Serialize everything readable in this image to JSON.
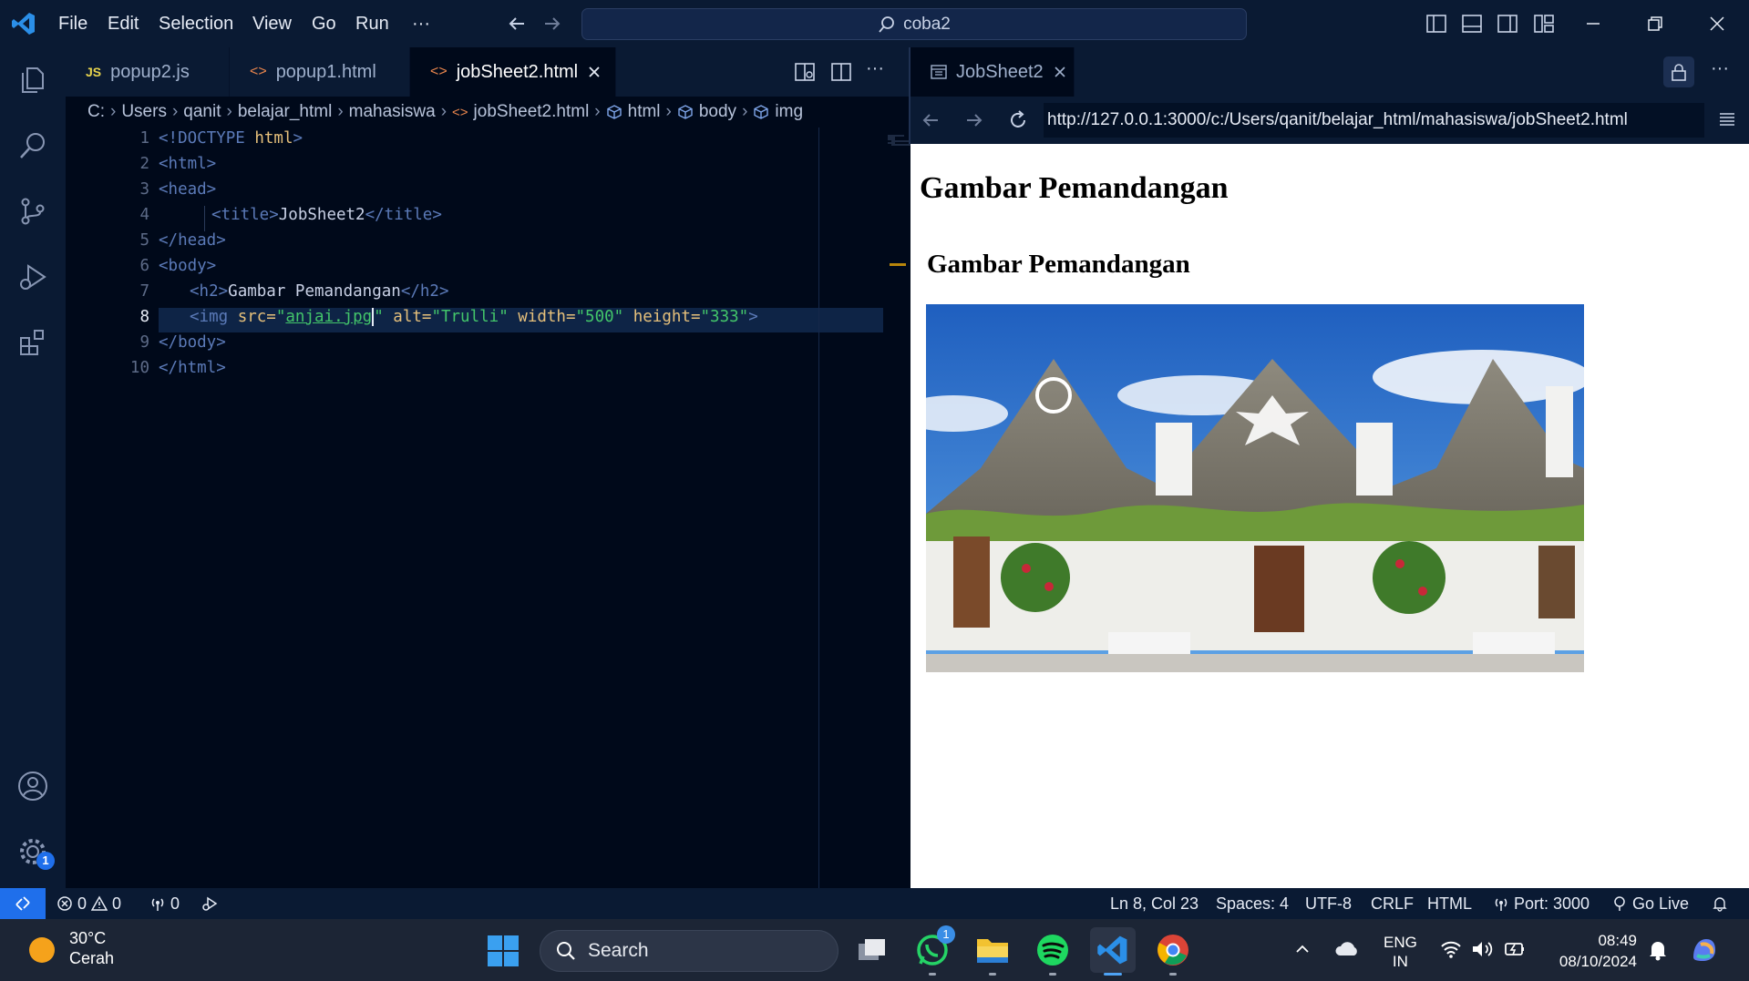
{
  "window": {
    "menu": [
      "File",
      "Edit",
      "Selection",
      "View",
      "Go",
      "Run"
    ],
    "more": "···",
    "search_text": "coba2"
  },
  "editor": {
    "tabs": [
      {
        "label": "popup2.js",
        "icon": "JS"
      },
      {
        "label": "popup1.html",
        "icon": "<>"
      },
      {
        "label": "jobSheet2.html",
        "icon": "<>"
      }
    ],
    "breadcrumb": [
      "C:",
      "Users",
      "qanit",
      "belajar_html",
      "mahasiswa",
      "jobSheet2.html",
      "html",
      "body",
      "img"
    ],
    "line_numbers": [
      "1",
      "2",
      "3",
      "4",
      "5",
      "6",
      "7",
      "8",
      "9",
      "10"
    ],
    "code": {
      "l1_doctype": "<!DOCTYPE",
      "l1_html": " html",
      "l1_close": ">",
      "l2": "<html>",
      "l3": "<head>",
      "l4_open": "<title>",
      "l4_text": "JobSheet2",
      "l4_close": "</title>",
      "l5": "</head>",
      "l6": "<body>",
      "l7_open": "<h2>",
      "l7_text": "Gambar Pemandangan",
      "l7_close": "</h2>",
      "l8_open": "<img",
      "l8_src_attr": " src=",
      "l8_src_q1": "\"",
      "l8_src_val": "anjai.jpg",
      "l8_src_q2": "\"",
      "l8_alt_attr": " alt=",
      "l8_alt_val": "\"Trulli\"",
      "l8_w_attr": " width=",
      "l8_w_val": "\"500\"",
      "l8_h_attr": " height=",
      "l8_h_val": "\"333\"",
      "l8_close": ">",
      "l9": "</body>",
      "l10": "</html>"
    }
  },
  "preview": {
    "tab_label": "JobSheet2",
    "url": "http://127.0.0.1:3000/c:/Users/qanit/belajar_html/mahasiswa/jobSheet2.html",
    "page_title": "Gambar Pemandangan",
    "heading": "Gambar Pemandangan"
  },
  "statusbar": {
    "errors": "0",
    "warnings": "0",
    "ports": "0",
    "position": "Ln 8, Col 23",
    "spaces": "Spaces: 4",
    "encoding": "UTF-8",
    "eol": "CRLF",
    "language": "HTML",
    "port": "Port: 3000",
    "golive": "Go Live",
    "settings_badge": "1"
  },
  "taskbar": {
    "weather_temp": "30°C",
    "weather_desc": "Cerah",
    "search": "Search",
    "whatsapp_badge": "1",
    "lang_line1": "ENG",
    "lang_line2": "IN",
    "time": "08:49",
    "date": "08/10/2024"
  },
  "colors": {
    "accent": "#1f6feb",
    "editor_bg": "#00091a",
    "string": "#43c56a",
    "attribute": "#e6c07b"
  }
}
